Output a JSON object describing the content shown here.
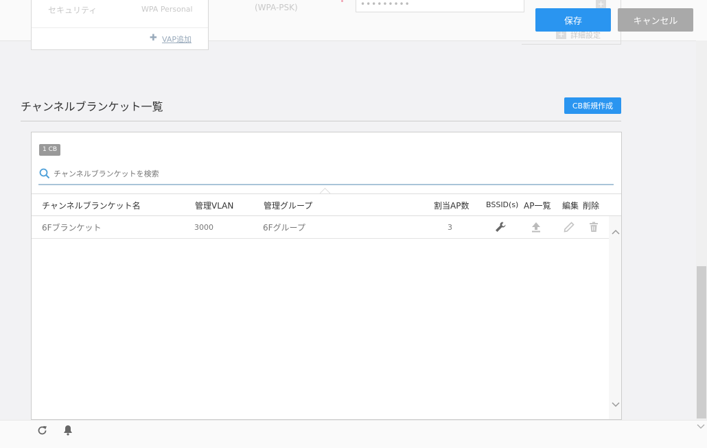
{
  "top": {
    "vap": {
      "security_label": "セキュリティ",
      "security_value": "WPA Personal",
      "add_link": "VAP追加"
    },
    "auth_mode": "(WPA-PSK)",
    "password_mask": "•••••••••",
    "detail_link": "詳細設定",
    "save_label": "保存",
    "cancel_label": "キャンセル"
  },
  "section": {
    "title": "チャンネルブランケット一覧",
    "new_button": "CB新規作成"
  },
  "table": {
    "badge": "1 CB",
    "search_placeholder": "チャンネルブランケットを検索",
    "columns": {
      "name": "チャンネルブランケット名",
      "vlan": "管理VLAN",
      "group": "管理グループ",
      "ap_count": "割当AP数",
      "bssid": "BSSID(s)",
      "ap_list": "AP一覧",
      "edit": "編集",
      "delete": "削除"
    },
    "rows": [
      {
        "name": "6Fブランケット",
        "vlan": "3000",
        "group": "6Fグループ",
        "ap_count": "3"
      }
    ]
  },
  "icons": {
    "bssid": "wrench-icon",
    "ap_list": "upload-icon",
    "edit": "pencil-icon",
    "delete": "trash-icon",
    "refresh": "refresh-icon",
    "notifications": "bell-icon",
    "search": "search-icon"
  },
  "colors": {
    "primary": "#2a95f0",
    "cancel": "#a9a9a9",
    "badge": "#999999",
    "search_line": "#a9c4d8"
  }
}
